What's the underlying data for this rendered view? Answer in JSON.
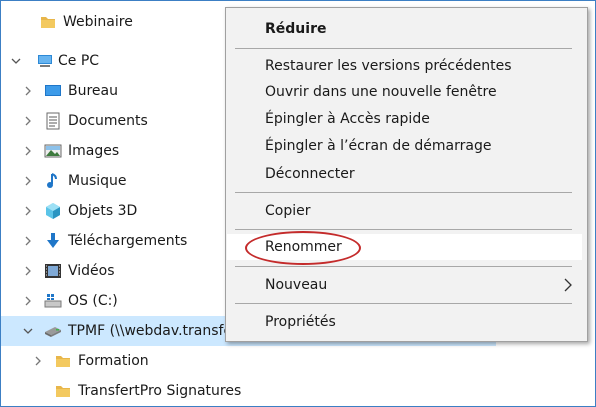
{
  "tree": {
    "items": [
      {
        "label": "Webinaire",
        "icon": "folder-icon"
      },
      {
        "label": "Ce PC",
        "icon": "computer-icon"
      },
      {
        "label": "Bureau",
        "icon": "desktop-icon"
      },
      {
        "label": "Documents",
        "icon": "documents-icon"
      },
      {
        "label": "Images",
        "icon": "pictures-icon"
      },
      {
        "label": "Musique",
        "icon": "music-icon"
      },
      {
        "label": "Objets 3D",
        "icon": "3d-objects-icon"
      },
      {
        "label": "Téléchargements",
        "icon": "downloads-icon"
      },
      {
        "label": "Vidéos",
        "icon": "videos-icon"
      },
      {
        "label": "OS (C:)",
        "icon": "drive-icon"
      },
      {
        "label": "TPMF (\\\\webdav.transfe",
        "icon": "network-drive-icon"
      },
      {
        "label": "Formation",
        "icon": "folder-icon"
      },
      {
        "label": "TransfertPro Signatures",
        "icon": "folder-icon"
      }
    ]
  },
  "context_menu": {
    "items": [
      {
        "label": "Réduire",
        "bold": true
      },
      {
        "label": "Restaurer les versions précédentes"
      },
      {
        "label": "Ouvrir dans une nouvelle fenêtre"
      },
      {
        "label": "Épingler à Accès rapide"
      },
      {
        "label": "Épingler à l’écran de démarrage"
      },
      {
        "label": "Déconnecter"
      },
      {
        "label": "Copier"
      },
      {
        "label": "Renommer",
        "highlighted": true
      },
      {
        "label": "Nouveau",
        "submenu": true
      },
      {
        "label": "Propriétés"
      }
    ]
  },
  "colors": {
    "selected_row": "#cce8ff",
    "highlight_circle": "#c42b2b",
    "folder": "#e8b64a",
    "accent": "#3c7fc4"
  }
}
